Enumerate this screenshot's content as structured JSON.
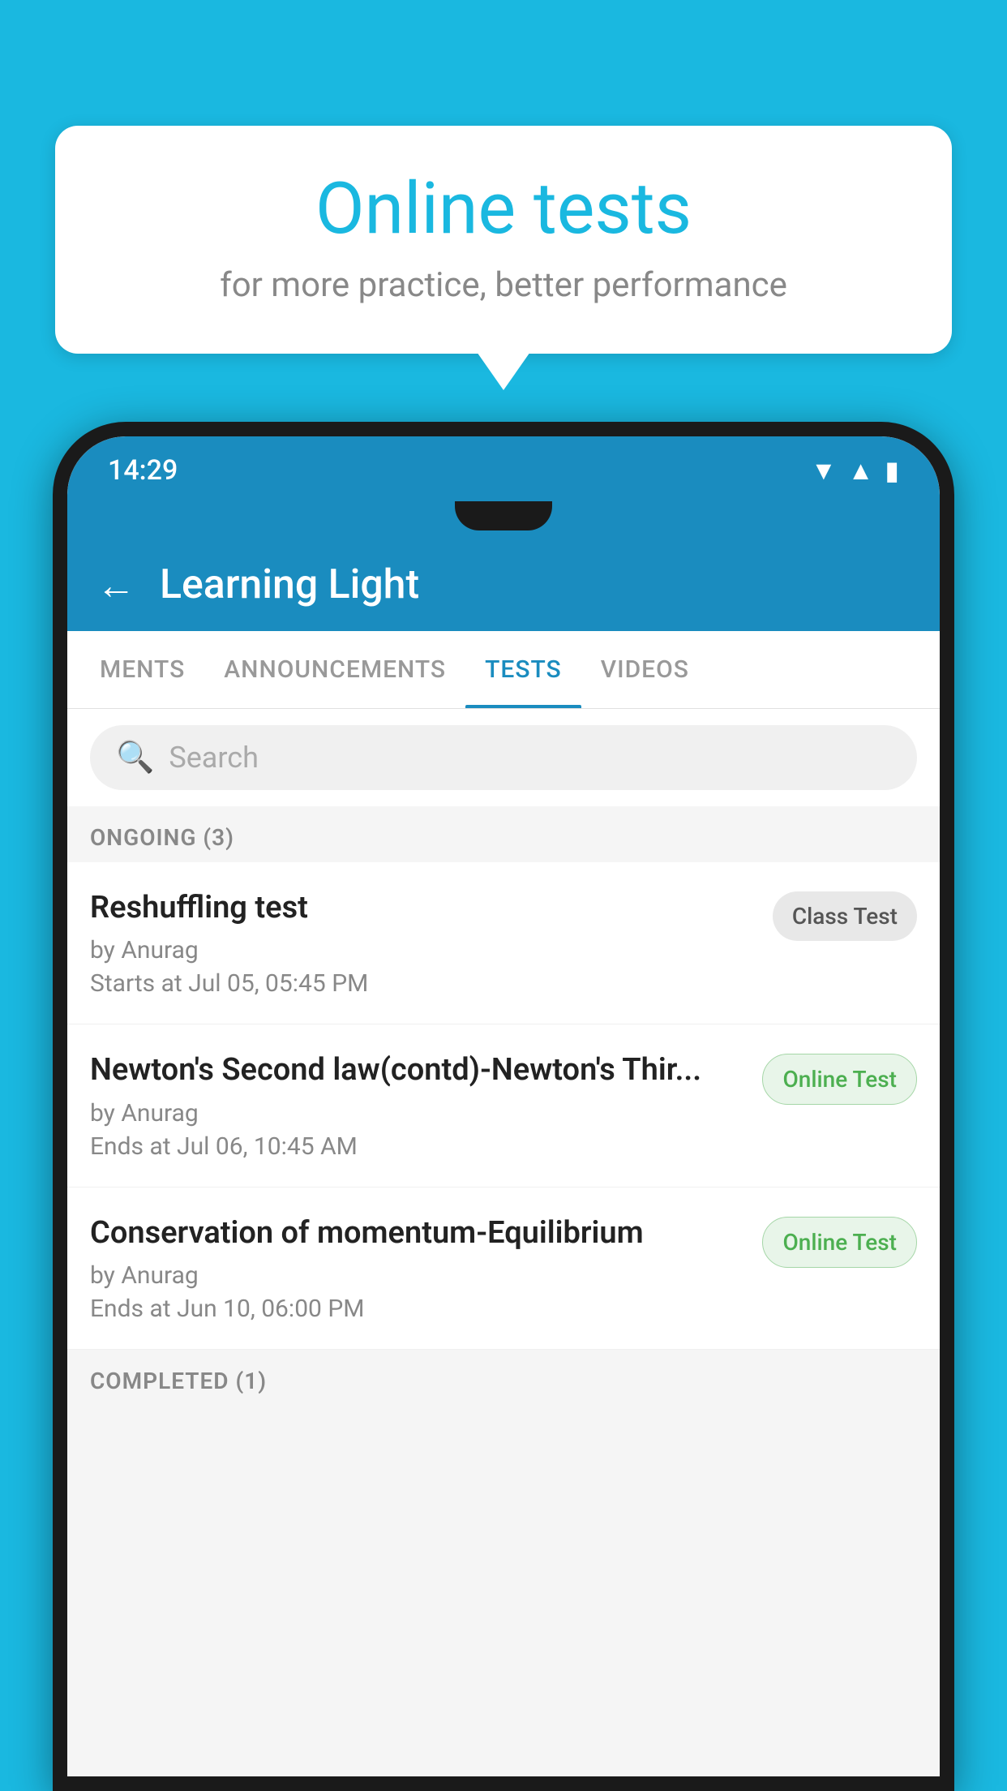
{
  "background": {
    "color": "#1ab8e0"
  },
  "speech_bubble": {
    "title": "Online tests",
    "subtitle": "for more practice, better performance"
  },
  "phone": {
    "status_bar": {
      "time": "14:29",
      "icons": [
        "wifi",
        "signal",
        "battery"
      ]
    },
    "app_header": {
      "back_label": "←",
      "title": "Learning Light"
    },
    "tabs": [
      {
        "label": "MENTS",
        "active": false
      },
      {
        "label": "ANNOUNCEMENTS",
        "active": false
      },
      {
        "label": "TESTS",
        "active": true
      },
      {
        "label": "VIDEOS",
        "active": false
      }
    ],
    "search": {
      "placeholder": "Search"
    },
    "ongoing_section": {
      "label": "ONGOING (3)"
    },
    "test_items": [
      {
        "name": "Reshuffling test",
        "by": "by Anurag",
        "date": "Starts at  Jul 05, 05:45 PM",
        "badge": "Class Test",
        "badge_type": "class"
      },
      {
        "name": "Newton's Second law(contd)-Newton's Thir...",
        "by": "by Anurag",
        "date": "Ends at  Jul 06, 10:45 AM",
        "badge": "Online Test",
        "badge_type": "online"
      },
      {
        "name": "Conservation of momentum-Equilibrium",
        "by": "by Anurag",
        "date": "Ends at  Jun 10, 06:00 PM",
        "badge": "Online Test",
        "badge_type": "online"
      }
    ],
    "completed_section": {
      "label": "COMPLETED (1)"
    }
  }
}
